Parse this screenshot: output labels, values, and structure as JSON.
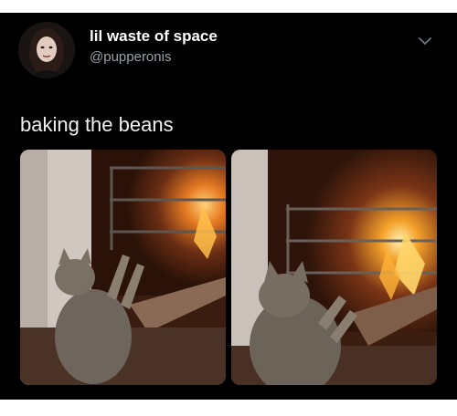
{
  "tweet": {
    "display_name": "lil waste of space",
    "handle": "@pupperonis",
    "text": "baking the beans"
  },
  "media": {
    "photos": [
      {
        "description_icon": "cat-by-fireplace-photo"
      },
      {
        "description_icon": "cat-by-fireplace-closeup-photo"
      }
    ]
  },
  "colors": {
    "background": "#000000",
    "page": "#ffffff",
    "text": "#f1f1f1",
    "handle": "#9aa2aa",
    "fire": "#f4a12a"
  },
  "icons": {
    "menu": "chevron-down-icon",
    "avatar": "avatar-image"
  }
}
